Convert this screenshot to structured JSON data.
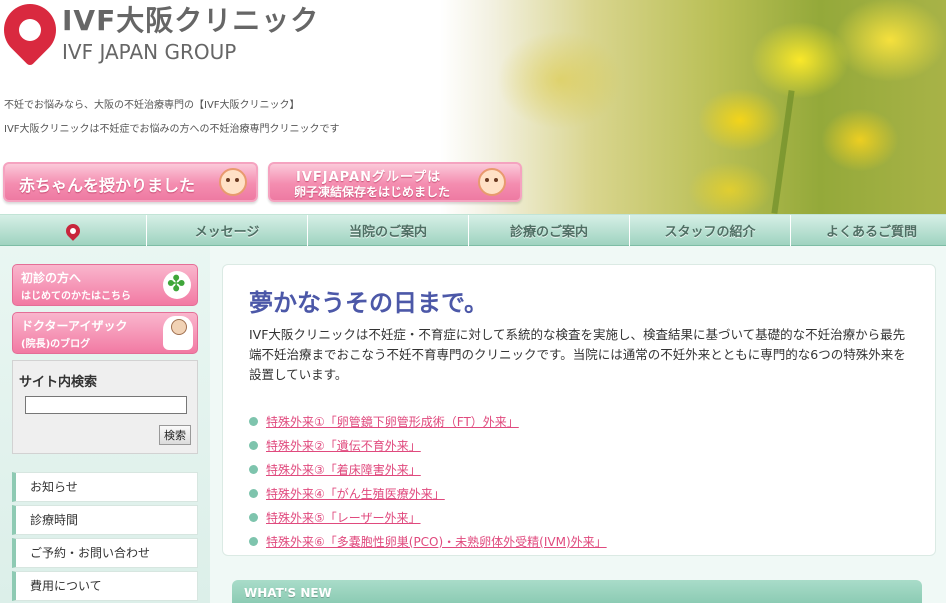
{
  "header": {
    "logo_title": "IVF大阪クリニック",
    "logo_subtitle": "IVF JAPAN GROUP",
    "tagline1": "不妊でお悩みなら、大阪の不妊治療専門の【IVF大阪クリニック】",
    "tagline2": "IVF大阪クリニックは不妊症でお悩みの方への不妊治療専門クリニックです",
    "banner1": "赤ちゃんを授かりました",
    "banner2_line1": "IVFJAPANグループは",
    "banner2_line2": "卵子凍結保存をはじめました"
  },
  "nav": {
    "items": [
      "メッセージ",
      "当院のご案内",
      "診療のご案内",
      "スタッフの紹介",
      "よくあるご質問"
    ]
  },
  "sidebar": {
    "banner1_line1": "初診の方へ",
    "banner1_line2": "はじめてのかたはこちら",
    "banner2_line1": "ドクターアイザック",
    "banner2_line2": "(院長)のブログ",
    "search_title": "サイト内検索",
    "search_value": "",
    "search_button": "検索",
    "menu": [
      "お知らせ",
      "診療時間",
      "ご予約・お問い合わせ",
      "費用について"
    ]
  },
  "main": {
    "headline": "夢かなうその日まで。",
    "intro": "IVF大阪クリニックは不妊症・不育症に対して系統的な検査を実施し、検査結果に基づいて基礎的な不妊治療から最先端不妊治療までおこなう不妊不育専門のクリニックです。当院には通常の不妊外来とともに専門的な6つの特殊外来を設置しています。",
    "clinics": [
      "特殊外来①「卵管鏡下卵管形成術（FT）外来」",
      "特殊外来②「遺伝不育外来」",
      "特殊外来③「着床障害外来」",
      "特殊外来④「がん生殖医療外来」",
      "特殊外来⑤「レーザー外来」",
      "特殊外来⑥「多嚢胞性卵巣(PCO)・未熟卵体外受精(IVM)外来」"
    ],
    "whats_new": "WHAT'S NEW"
  },
  "colors": {
    "brand_red": "#d9293f",
    "pink_accent": "#f27aa3",
    "mint_nav": "#9fd3c0",
    "headline_blue": "#4c58a8",
    "link_pink": "#e04a7e"
  }
}
